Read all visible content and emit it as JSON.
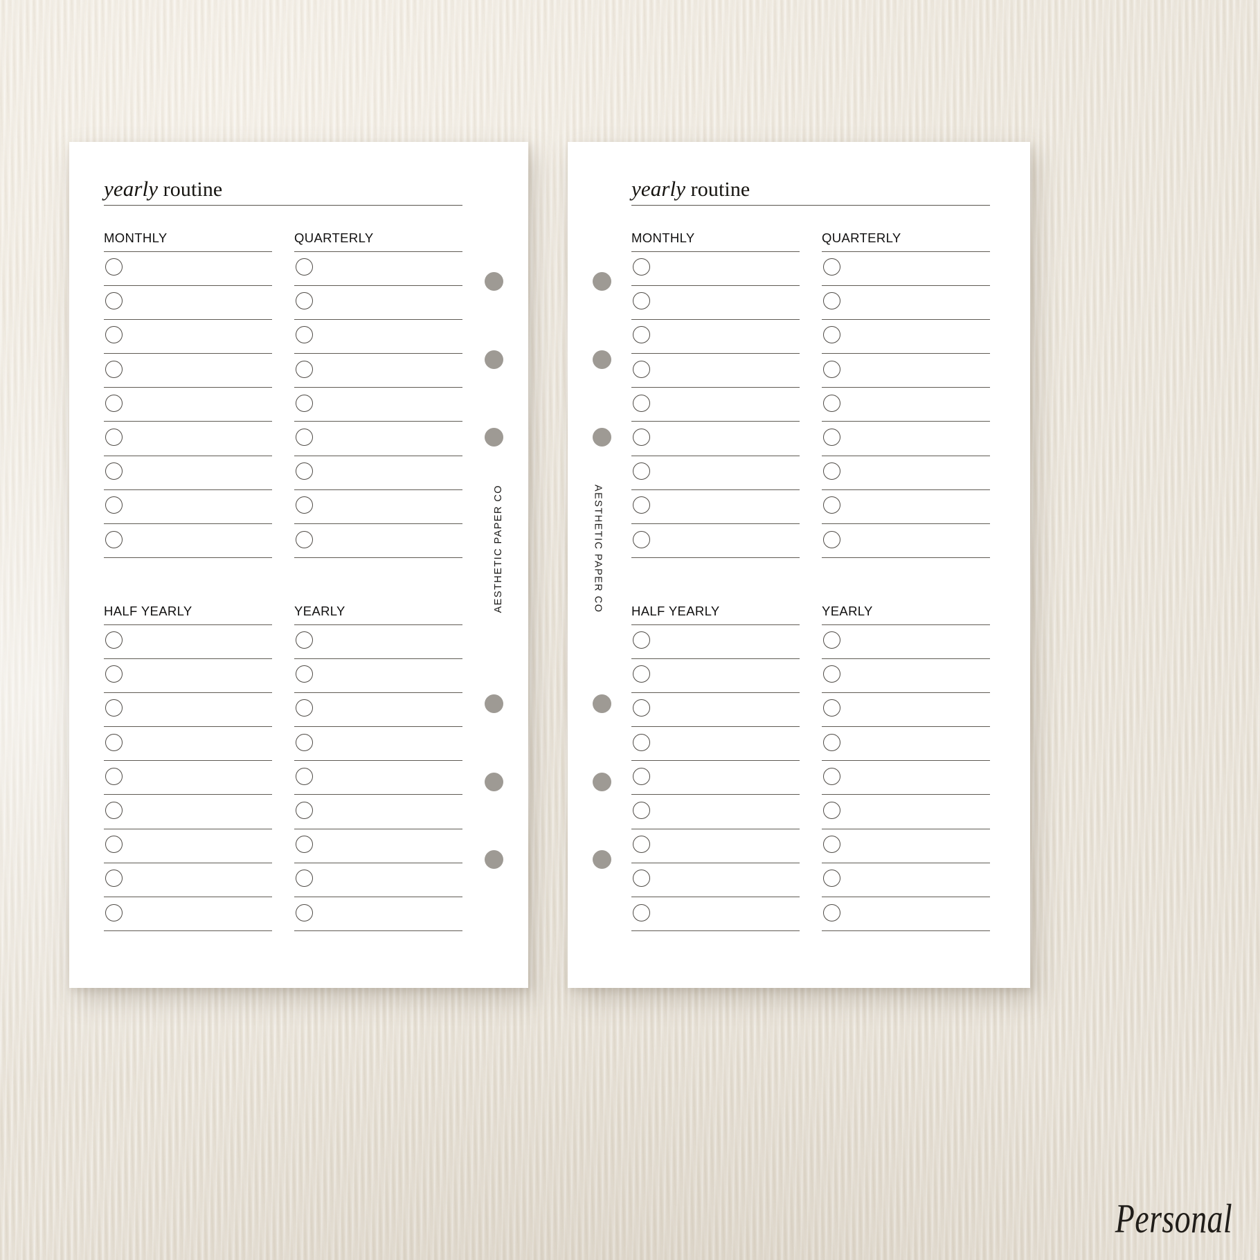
{
  "product": {
    "caption": "Personal",
    "brand": "AESTHETIC PAPER CO",
    "background_color": "#ece7dd",
    "paper_color": "#ffffff",
    "rule_color": "#5e5a53",
    "hole_color": "#9e9a94"
  },
  "spread": {
    "pages": [
      {
        "id": "page-left",
        "side": "left",
        "holes_side": "right"
      },
      {
        "id": "page-right",
        "side": "right",
        "holes_side": "left"
      }
    ],
    "punch_hole_count_per_page": 6
  },
  "sheet": {
    "title": {
      "italic_word": "yearly",
      "roman_word": "routine"
    },
    "sections": [
      {
        "id": "section-1",
        "columns": [
          {
            "id": "monthly",
            "heading": "MONTHLY",
            "row_count": 9
          },
          {
            "id": "quarterly",
            "heading": "QUARTERLY",
            "row_count": 9
          }
        ]
      },
      {
        "id": "section-2",
        "columns": [
          {
            "id": "half-yearly",
            "heading": "HALF YEARLY",
            "row_count": 9
          },
          {
            "id": "yearly",
            "heading": "YEARLY",
            "row_count": 9
          }
        ]
      }
    ]
  }
}
